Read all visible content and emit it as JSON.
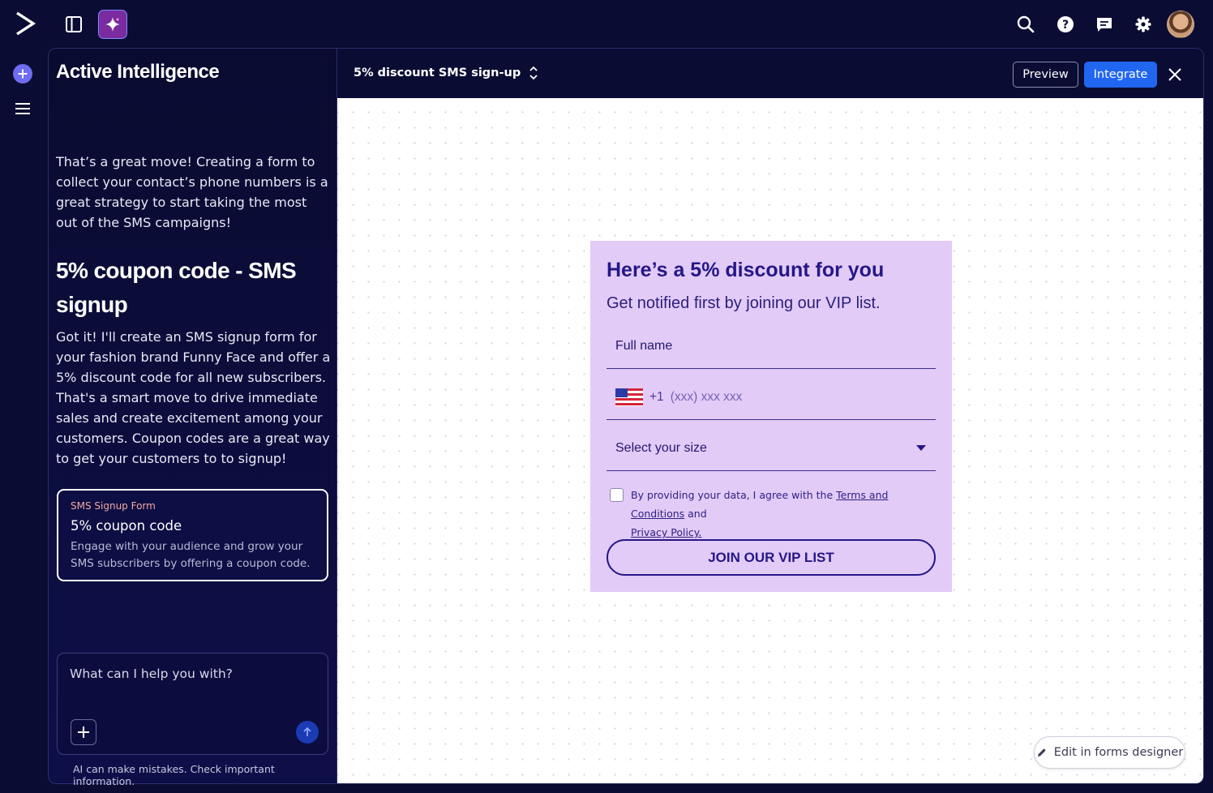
{
  "topbar": {
    "logo_icon": "activecampaign-chevron-icon",
    "icons": [
      "sidebar-toggle-icon",
      "sparkle-icon",
      "search-icon",
      "help-icon",
      "chat-icon",
      "gear-icon",
      "avatar"
    ]
  },
  "chat": {
    "title": "Active Intelligence",
    "message1": "That’s a great move! Creating a form to collect your contact’s phone numbers is a great strategy to start taking the most out of the SMS campaigns!",
    "heading": "5% coupon code - SMS signup",
    "message2": "Got it! I'll create an SMS signup form for your fashion brand Funny Face and offer a 5% discount code for all new subscribers. That's a smart move to drive immediate sales and create excitement among your customers. Coupon codes are a great way to get your customers to to signup!",
    "card": {
      "tag": "SMS Signup Form",
      "title": "5% coupon code",
      "description": "Engage with your audience and grow your SMS subscribers by offering a coupon code."
    },
    "composer": {
      "placeholder": "What can I help you with?"
    },
    "disclaimer": "AI can make mistakes. Check important information."
  },
  "pane": {
    "form_name": "5% discount SMS sign-up",
    "preview_label": "Preview",
    "integrate_label": "Integrate",
    "edit_label": "Edit in forms designer"
  },
  "form": {
    "title": "Here’s a 5% discount for you",
    "subtitle": "Get notified first by joining our VIP list.",
    "full_name_label": "Full name",
    "phone_code": "+1",
    "phone_placeholder": "(xxx) xxx xxx",
    "size_label": "Select your size",
    "consent_prefix": "By providing your data, I agree with the ",
    "terms_label": "Terms and Conditions",
    "consent_mid": " and ",
    "privacy_label": "Privacy Policy.",
    "submit_label": "JOIN OUR VIP LIST"
  },
  "colors": {
    "background": "#0b0c33",
    "accent": "#2166f0",
    "form_bg": "#e3cbf7",
    "form_text": "#241788",
    "card_tag": "#f1a9a0"
  }
}
